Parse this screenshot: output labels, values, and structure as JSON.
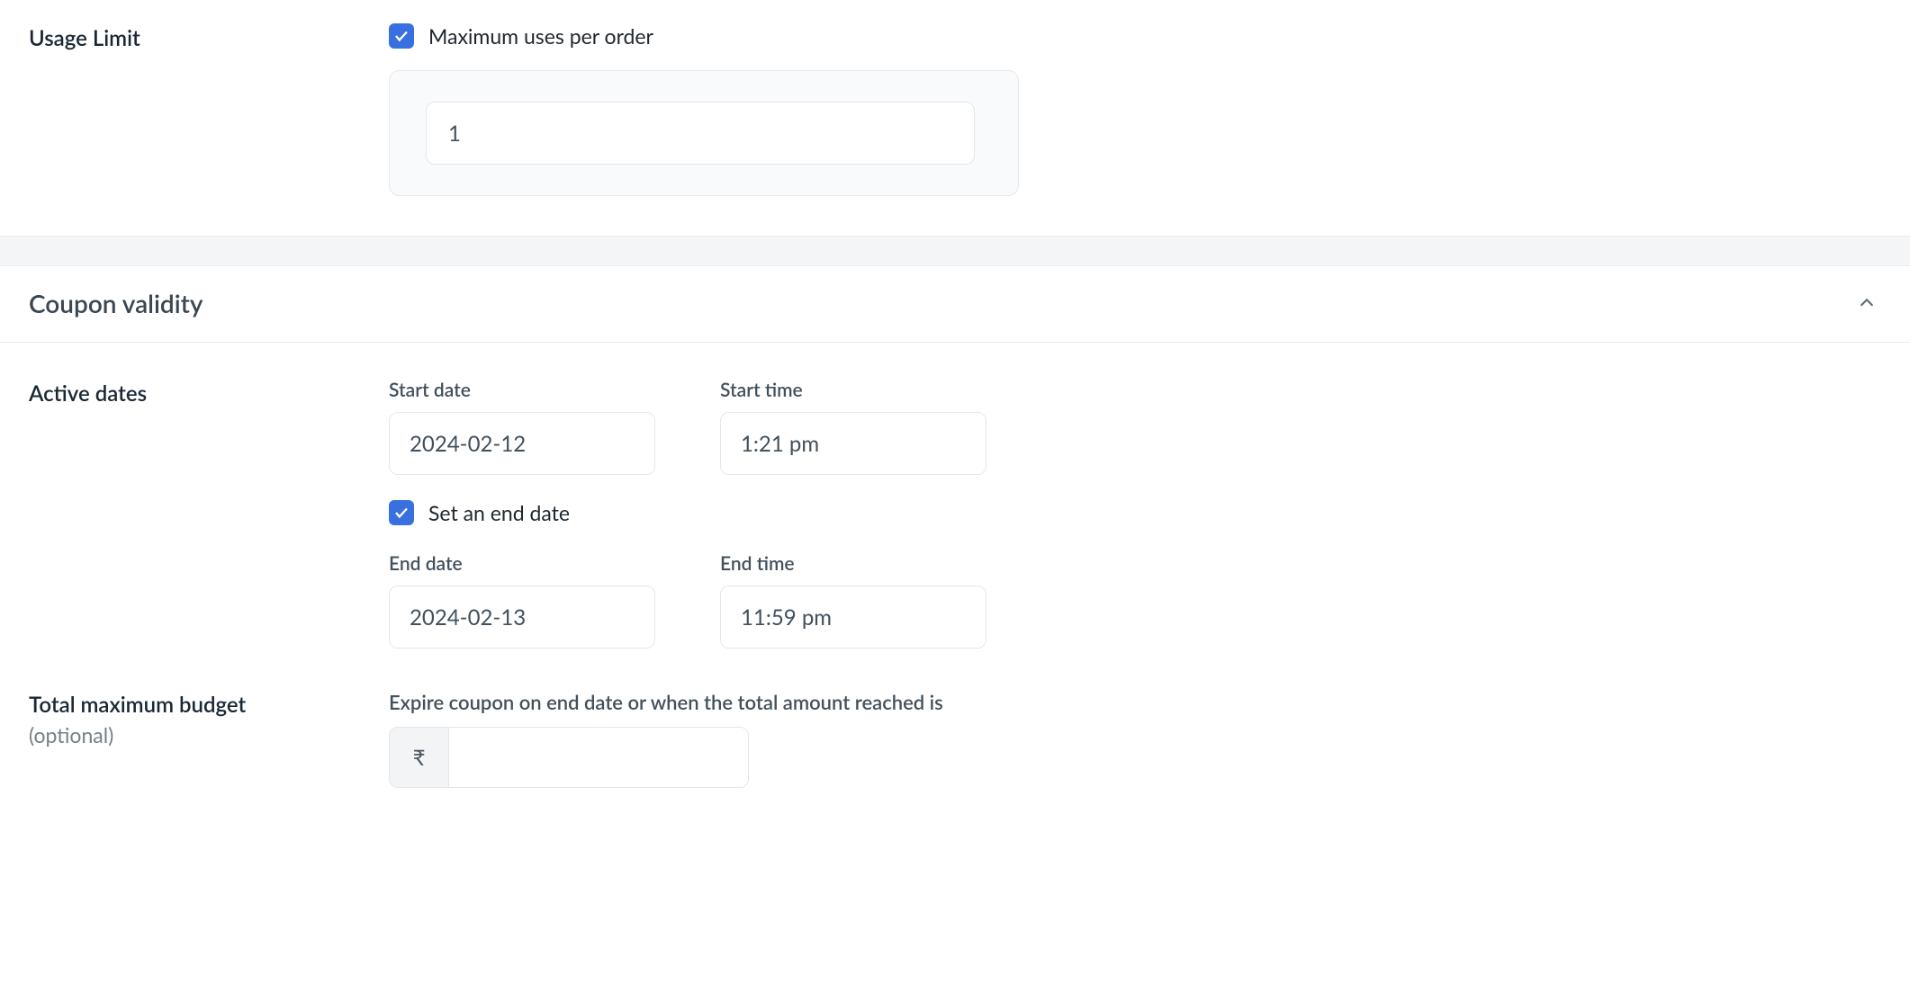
{
  "usageLimit": {
    "label": "Usage Limit",
    "checkboxLabel": "Maximum uses per order",
    "value": "1"
  },
  "couponValidity": {
    "title": "Coupon validity"
  },
  "activeDates": {
    "label": "Active dates",
    "startDateLabel": "Start date",
    "startDateValue": "2024-02-12",
    "startTimeLabel": "Start time",
    "startTimeValue": "1:21 pm",
    "setEndDateLabel": "Set an end date",
    "endDateLabel": "End date",
    "endDateValue": "2024-02-13",
    "endTimeLabel": "End time",
    "endTimeValue": "11:59 pm"
  },
  "budget": {
    "label": "Total maximum budget",
    "optional": "(optional)",
    "description": "Expire coupon on end date or when the total amount reached is",
    "currency": "₹",
    "value": ""
  }
}
